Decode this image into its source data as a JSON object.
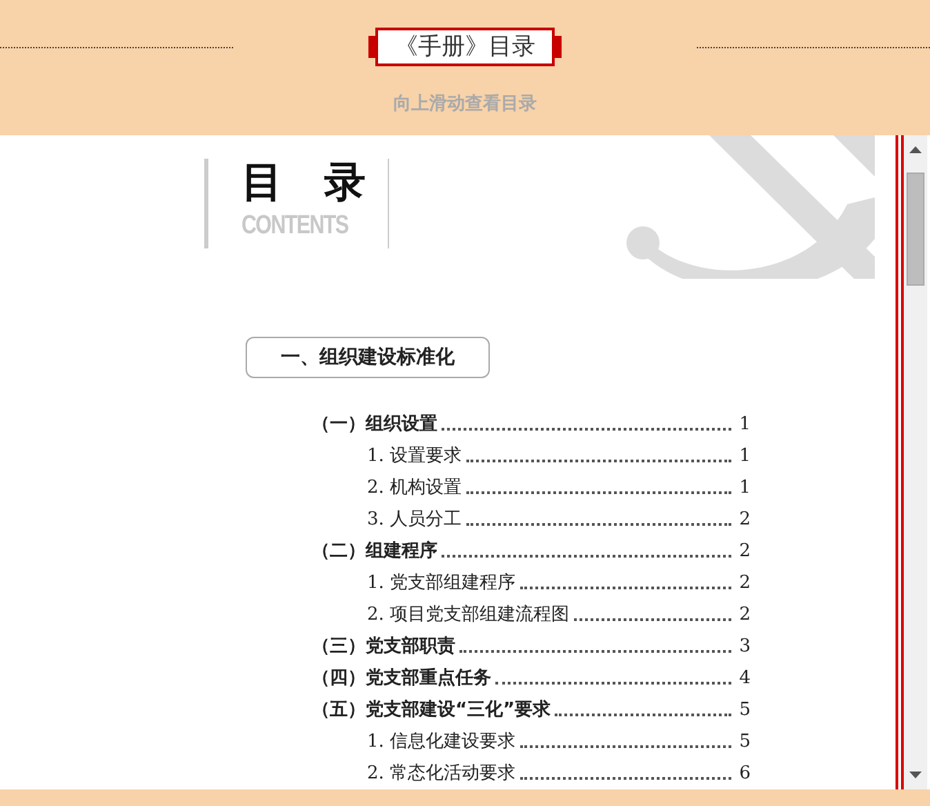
{
  "header": {
    "title": "《手册》目录",
    "hint": "向上滑动查看目录"
  },
  "document": {
    "heading": "目　录",
    "heading_en": "CONTENTS",
    "section": "一、组织建设标准化",
    "entries": [
      {
        "label": "（一）组织设置",
        "page": "1",
        "children": [
          {
            "label": "1. 设置要求",
            "page": "1"
          },
          {
            "label": "2. 机构设置",
            "page": "1"
          },
          {
            "label": "3. 人员分工",
            "page": "2"
          }
        ]
      },
      {
        "label": "（二）组建程序",
        "page": "2",
        "children": [
          {
            "label": "1. 党支部组建程序",
            "page": "2"
          },
          {
            "label": "2. 项目党支部组建流程图",
            "page": "2"
          }
        ]
      },
      {
        "label": "（三）党支部职责",
        "page": "3"
      },
      {
        "label": "（四）党支部重点任务",
        "page": "4"
      },
      {
        "label": "（五）党支部建设“三化”要求",
        "page": "5",
        "children": [
          {
            "label": "1. 信息化建设要求",
            "page": "5"
          },
          {
            "label": "2. 常态化活动要求",
            "page": "6"
          }
        ]
      }
    ]
  }
}
